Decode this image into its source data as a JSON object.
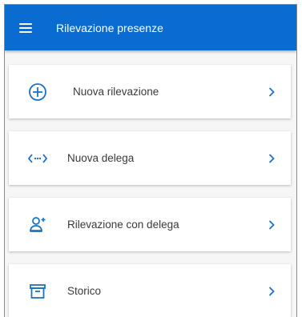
{
  "appbar": {
    "title": "Rilevazione presenze",
    "menu_icon": "hamburger-menu-icon",
    "color": "#0a6bd0"
  },
  "menu": {
    "items": [
      {
        "label": "Nuova rilevazione",
        "icon": "plus-circle-icon"
      },
      {
        "label": "Nuova delega",
        "icon": "code-arrows-icon"
      },
      {
        "label": "Rilevazione con delega",
        "icon": "person-add-icon"
      },
      {
        "label": "Storico",
        "icon": "archive-box-icon"
      }
    ],
    "accent_color": "#1a73c8",
    "chevron_icon": "chevron-right-icon"
  }
}
